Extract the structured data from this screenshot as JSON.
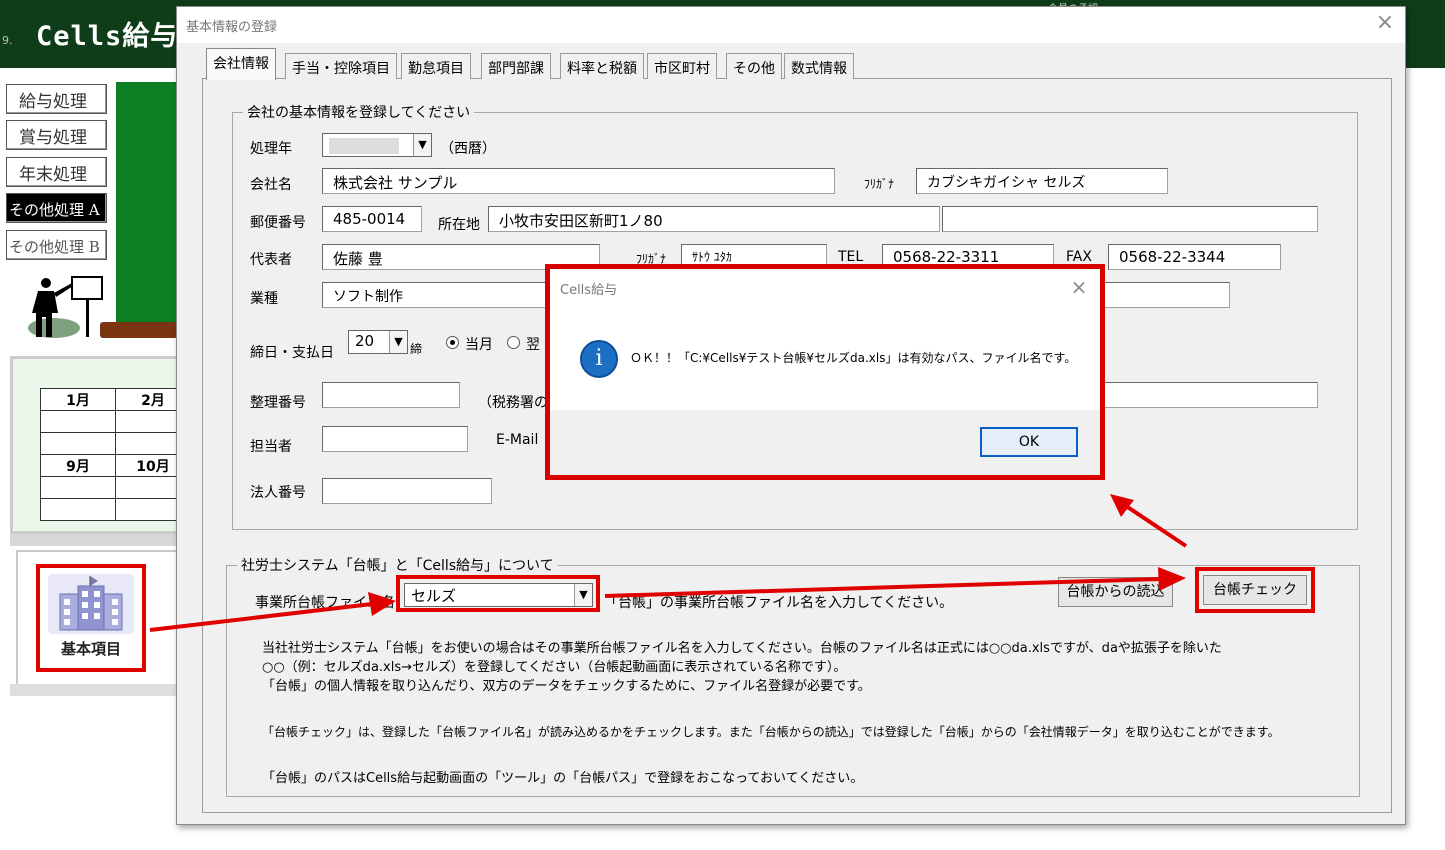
{
  "app": {
    "title": "Cells給与",
    "header_left": "9.",
    "header_right": "会員の承認",
    "menu": [
      "給与処理",
      "賞与処理",
      "年末処理",
      "その他処理 A",
      "その他処理 B"
    ],
    "calendar": [
      "1月",
      "2月",
      "9月",
      "10月"
    ],
    "kihon_label": "基本項目"
  },
  "dialog": {
    "title": "基本情報の登録",
    "close": "×",
    "tabs": [
      "会社情報",
      "手当・控除項目",
      "勤怠項目",
      "部門部課",
      "料率と税額",
      "市区町村",
      "その他",
      "数式情報"
    ],
    "company_group": {
      "legend": "会社の基本情報を登録してください",
      "year_label": "処理年",
      "year_value": "",
      "year_suffix": "（西暦）",
      "name_label": "会社名",
      "name_value": "株式会社 サンプル",
      "furigana_label": "ﾌﾘｶﾞﾅ",
      "furigana_value": "カブシキガイシャ セルズ",
      "postal_label": "郵便番号",
      "postal_value": "485-0014",
      "address_label": "所在地",
      "address_value": "小牧市安田区新町1ノ80",
      "address2_value": "",
      "rep_label": "代表者",
      "rep_value": "佐藤 豊",
      "rep_furigana_label": "ﾌﾘｶﾞﾅ",
      "rep_furigana_value": "ｻﾄｳ ﾕﾀｶ",
      "tel_label": "TEL",
      "tel_value": "0568-22-3311",
      "fax_label": "FAX",
      "fax_value": "0568-22-3344",
      "industry_label": "業種",
      "industry_value": "ソフト制作",
      "closing_label": "締日・支払日",
      "closing_value": "20",
      "closing_suffix": "締",
      "radio_current": "当月",
      "radio_next": "翌",
      "seiri_label": "整理番号",
      "seiri_note": "（税務署の",
      "tanto_label": "担当者",
      "email_label": "E-Mail",
      "houjin_label": "法人番号"
    },
    "sharoushi_group": {
      "legend": "社労士システム「台帳」と「Cells給与」について",
      "ledger_label": "事業所台帳ファイル名",
      "ledger_value": "セルズ",
      "ledger_hint": "「台帳」の事業所台帳ファイル名を入力してください。",
      "read_button": "台帳からの読込",
      "check_button": "台帳チェック",
      "text1": "当社社労士システム「台帳」をお使いの場合はその事業所台帳ファイル名を入力してください。台帳のファイル名は正式には○○da.xlsですが、daや拡張子を除いた",
      "text2": "○○（例：セルズda.xls→セルズ）を登録してください（台帳起動画面に表示されている名称です）。",
      "text3": "「台帳」の個人情報を取り込んだり、双方のデータをチェックするために、ファイル名登録が必要です。",
      "text4": "「台帳チェック」は、登録した「台帳ファイル名」が読み込めるかをチェックします。また「台帳からの読込」では登録した「台帳」からの「会社情報データ」を取り込むことができます。",
      "text5": "「台帳」のパスはCells給与起動画面の「ツール」の「台帳パス」で登録をおこなっておいてください。"
    }
  },
  "message_box": {
    "title": "Cells給与",
    "close": "×",
    "icon": "i",
    "text": "ＯＫ！！「C:¥Cells¥テスト台帳¥セルズda.xls」は有効なパス、ファイル名です。",
    "ok": "OK"
  },
  "colors": {
    "header_green": "#0f3d1a",
    "panel_green": "#0c7f22",
    "highlight_red": "#e00000",
    "info_blue": "#1c6fc3"
  }
}
